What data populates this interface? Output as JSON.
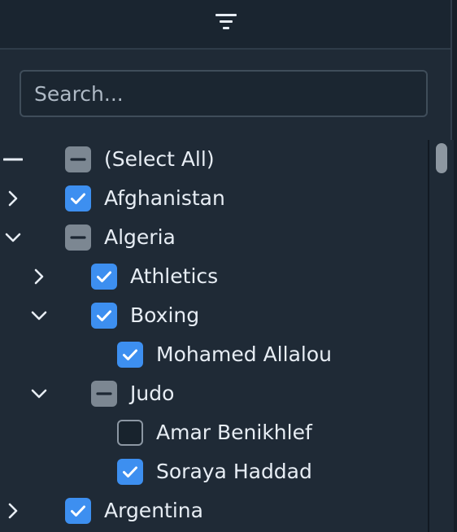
{
  "header": {
    "filter_icon": "filter-lines-icon"
  },
  "search": {
    "placeholder": "Search...",
    "value": ""
  },
  "tree": {
    "rows": [
      {
        "label": "(Select All)",
        "level": 0,
        "expander": "collapse-dash",
        "state": "indeterminate"
      },
      {
        "label": "Afghanistan",
        "level": 0,
        "expander": "chevron-right",
        "state": "checked"
      },
      {
        "label": "Algeria",
        "level": 0,
        "expander": "chevron-down",
        "state": "indeterminate"
      },
      {
        "label": "Athletics",
        "level": 1,
        "expander": "chevron-right",
        "state": "checked"
      },
      {
        "label": "Boxing",
        "level": 1,
        "expander": "chevron-down",
        "state": "checked"
      },
      {
        "label": "Mohamed Allalou",
        "level": 2,
        "expander": "none",
        "state": "checked"
      },
      {
        "label": "Judo",
        "level": 1,
        "expander": "chevron-down",
        "state": "indeterminate"
      },
      {
        "label": "Amar Benikhlef",
        "level": 2,
        "expander": "none",
        "state": "unchecked"
      },
      {
        "label": "Soraya Haddad",
        "level": 2,
        "expander": "none",
        "state": "checked"
      },
      {
        "label": "Argentina",
        "level": 0,
        "expander": "chevron-right",
        "state": "checked"
      }
    ]
  },
  "colors": {
    "background": "#1f2a36",
    "checkbox_checked": "#3d8ff0",
    "checkbox_indeterminate": "#7c8792",
    "text": "#e7edf4"
  }
}
